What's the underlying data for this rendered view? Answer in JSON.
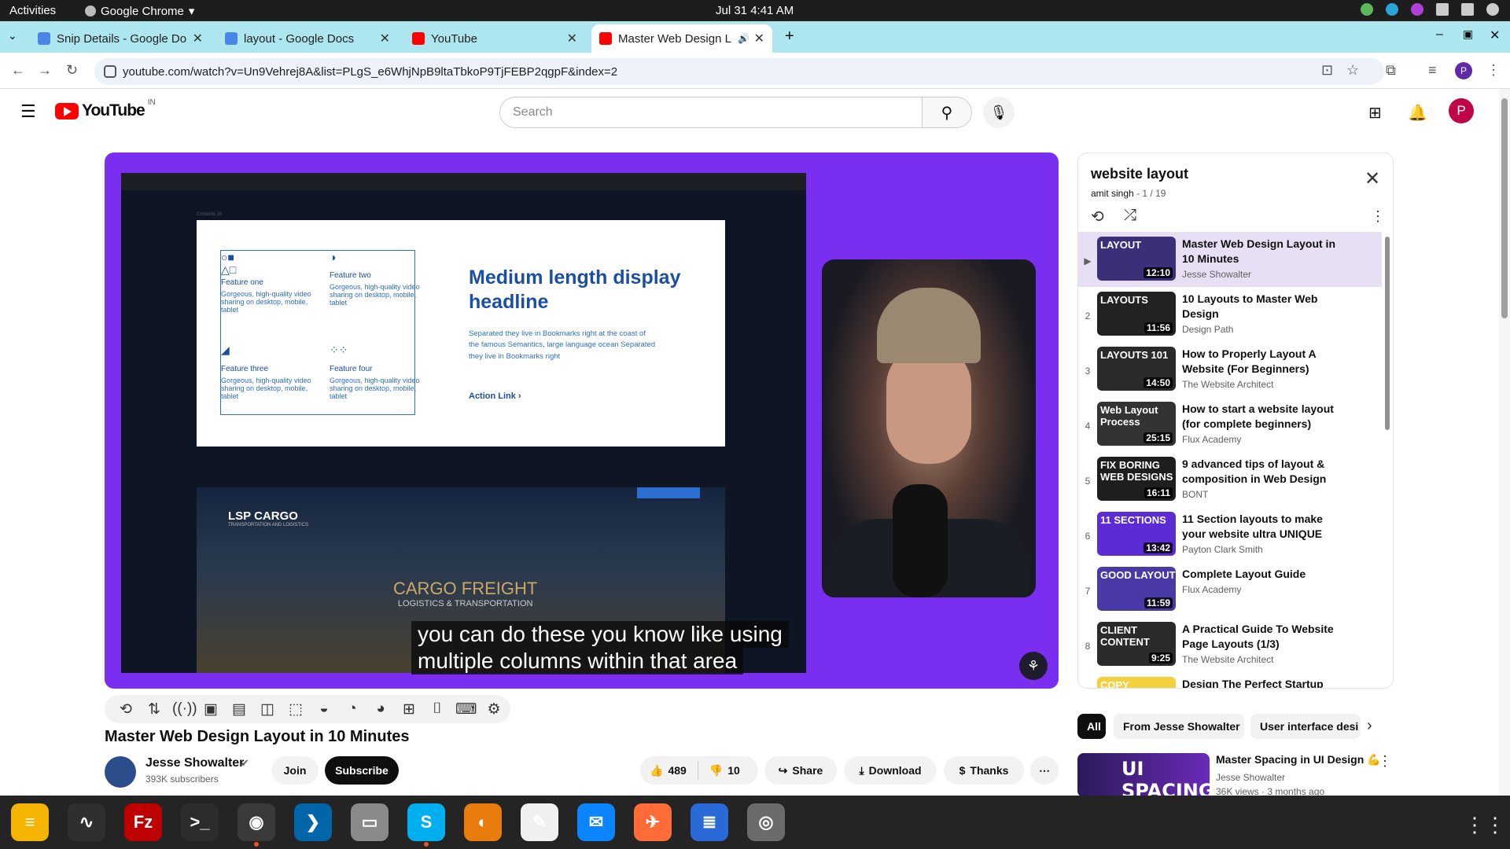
{
  "system": {
    "activities": "Activities",
    "app_name": "Google Chrome",
    "clock": "Jul 31  4:41 AM"
  },
  "tabs": [
    {
      "title": "Snip Details - Google Do",
      "icon": "docs-icon"
    },
    {
      "title": "layout - Google Docs",
      "icon": "docs-icon"
    },
    {
      "title": "YouTube",
      "icon": "youtube-icon"
    },
    {
      "title": "Master Web Design L",
      "icon": "youtube-icon",
      "active": true
    }
  ],
  "address": {
    "url": "youtube.com/watch?v=Un9Vehrej8A&list=PLgS_e6WhjNpB9ltaTbkoP9TjFEBP2qgpF&index=2"
  },
  "yt": {
    "logo": "YouTube",
    "country": "IN",
    "search_placeholder": "Search",
    "avatar_letter": "P"
  },
  "video": {
    "slide": {
      "contents_label": "Contents 16",
      "features": [
        {
          "name": "Feature one",
          "desc": "Gorgeous, high-quality video sharing on desktop, mobile, tablet"
        },
        {
          "name": "Feature two",
          "desc": "Gorgeous, high-quality video sharing on desktop, mobile, tablet"
        },
        {
          "name": "Feature three",
          "desc": "Gorgeous, high-quality video sharing on desktop, mobile, tablet"
        },
        {
          "name": "Feature four",
          "desc": "Gorgeous, high-quality video sharing on desktop, mobile, tablet"
        }
      ],
      "headline": "Medium length display headline",
      "body": "Separated they live in Bookmarks right at the coast of the famous Semantics, large language ocean Separated they live in Bookmarks right",
      "action": "Action Link ›"
    },
    "cargo": {
      "logo": "LSP CARGO",
      "logo_sub": "TRANSPORTATION AND LOGISTICS",
      "headline": "CARGO FREIGHT",
      "sub": "LOGISTICS & TRANSPORTATION"
    },
    "caption_line1": "you can do these you know like using",
    "caption_line2": "multiple columns within that area"
  },
  "details": {
    "title": "Master Web Design Layout in 10 Minutes",
    "channel": "Jesse Showalter",
    "subscribers": "393K subscribers",
    "join": "Join",
    "subscribe": "Subscribe",
    "likes": "489",
    "dislikes": "10",
    "share": "Share",
    "download": "Download",
    "thanks": "Thanks"
  },
  "playlist": {
    "title": "website layout",
    "owner": "amit singh",
    "position": "1 / 19",
    "items": [
      {
        "num": "▶",
        "title": "Master Web Design Layout in 10 Minutes",
        "channel": "Jesse Showalter",
        "duration": "12:10",
        "thumb_label": "LAYOUT",
        "thumb_color": "#3b2f7a",
        "current": true
      },
      {
        "num": "2",
        "title": "10 Layouts to Master Web Design",
        "channel": "Design Path",
        "duration": "11:56",
        "thumb_label": "LAYOUTS",
        "thumb_color": "#222222"
      },
      {
        "num": "3",
        "title": "How to Properly Layout A Website (For Beginners)",
        "channel": "The Website Architect",
        "duration": "14:50",
        "thumb_label": "LAYOUTS 101",
        "thumb_color": "#2a2a2a"
      },
      {
        "num": "4",
        "title": "How to start a website layout (for complete beginners)",
        "channel": "Flux Academy",
        "duration": "25:15",
        "thumb_label": "Web Layout Process",
        "thumb_color": "#333333"
      },
      {
        "num": "5",
        "title": "9 advanced tips of layout & composition in Web Design",
        "channel": "BONT",
        "duration": "16:11",
        "thumb_label": "FIX BORING WEB DESIGNS",
        "thumb_color": "#1e1e1e"
      },
      {
        "num": "6",
        "title": "11 Section layouts to make your website ultra UNIQUE",
        "channel": "Payton Clark Smith",
        "duration": "13:42",
        "thumb_label": "11 SECTIONS",
        "thumb_color": "#5b2bd6"
      },
      {
        "num": "7",
        "title": "Complete Layout Guide",
        "channel": "Flux Academy",
        "duration": "11:59",
        "thumb_label": "GOOD LAYOUT",
        "thumb_color": "#4a3aa8"
      },
      {
        "num": "8",
        "title": "A Practical Guide To Website Page Layouts (1/3)",
        "channel": "The Website Architect",
        "duration": "9:25",
        "thumb_label": "CLIENT CONTENT",
        "thumb_color": "#2b2b2b"
      },
      {
        "num": "9",
        "title": "Design The Perfect Startup",
        "channel": "",
        "duration": "",
        "thumb_label": "COPY",
        "thumb_color": "#f4d03f"
      }
    ]
  },
  "chips": [
    {
      "label": "All",
      "active": true
    },
    {
      "label": "From Jesse Showalter"
    },
    {
      "label": "User interface desi"
    }
  ],
  "related": {
    "thumb_label": "UI SPACING",
    "title": "Master Spacing in UI Design 💪",
    "channel": "Jesse Showalter",
    "meta": "36K views · 3 months ago"
  },
  "dock": [
    {
      "name": "notes-app",
      "glyph": "≡",
      "color": "#f4b400"
    },
    {
      "name": "system-monitor-app",
      "glyph": "∿",
      "color": "#2f2f2f"
    },
    {
      "name": "filezilla-app",
      "glyph": "Fz",
      "color": "#bf0000"
    },
    {
      "name": "terminal-app",
      "glyph": ">_",
      "color": "#2c2c2c"
    },
    {
      "name": "chrome-app",
      "glyph": "◉",
      "color": "#3a3a3a",
      "running": true
    },
    {
      "name": "vscode-app",
      "glyph": "❯",
      "color": "#0065a9"
    },
    {
      "name": "files-app",
      "glyph": "▭",
      "color": "#8a8a8a"
    },
    {
      "name": "skype-app",
      "glyph": "S",
      "color": "#00aff0",
      "running": true
    },
    {
      "name": "blender-app",
      "glyph": "◐",
      "color": "#e87d0d"
    },
    {
      "name": "text-editor-app",
      "glyph": "✎",
      "color": "#f0f0f0"
    },
    {
      "name": "thunderbird-app",
      "glyph": "✉",
      "color": "#0a84ff"
    },
    {
      "name": "postman-app",
      "glyph": "✈",
      "color": "#ff6c37"
    },
    {
      "name": "writer-app",
      "glyph": "≣",
      "color": "#2a6ad8"
    },
    {
      "name": "disks-app",
      "glyph": "◎",
      "color": "#6b6b6b"
    }
  ]
}
